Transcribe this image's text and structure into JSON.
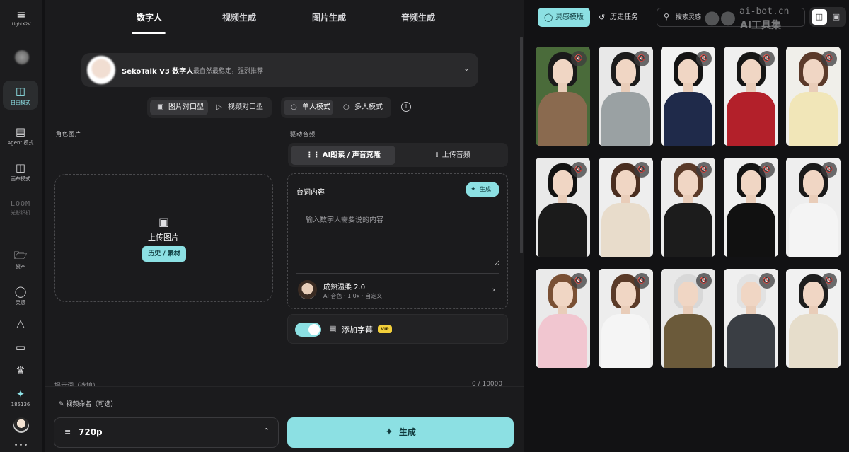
{
  "app": {
    "logo_text": "LightX2V"
  },
  "rail": {
    "items": [
      {
        "label": "自由模式",
        "icon": "cube-icon"
      },
      {
        "label": "Agent 模式",
        "icon": "robot-icon"
      },
      {
        "label": "画布模式",
        "icon": "layout-icon"
      },
      {
        "label": "LOOM",
        "sub": "光影织机",
        "icon": "loom-logo"
      },
      {
        "label": "资产",
        "icon": "folder-icon"
      },
      {
        "label": "灵感",
        "icon": "bulb-icon"
      },
      {
        "label": "",
        "icon": "bell-icon"
      },
      {
        "label": "",
        "icon": "monitor-icon"
      },
      {
        "label": "",
        "icon": "crown-icon"
      },
      {
        "label": "185136",
        "icon": "sparkle-icon"
      }
    ],
    "more": "•••"
  },
  "tabs": [
    "数字人",
    "视频生成",
    "图片生成",
    "音频生成"
  ],
  "model": {
    "name": "SekoTalk V3 数字人",
    "desc": "最自然最稳定，强烈推荐"
  },
  "lipsync": {
    "options": [
      "图片对口型",
      "视频对口型"
    ],
    "selected": "图片对口型"
  },
  "mode": {
    "options": [
      "单人模式",
      "多人模式"
    ],
    "selected": "单人模式"
  },
  "role_image": {
    "label": "角色图片",
    "upload_text": "上传图片",
    "history_button": "历史 / 素材"
  },
  "audio": {
    "label": "驱动音频",
    "tabs": [
      "AI朗读 / 声音克隆",
      "上传音频"
    ],
    "selected": "AI朗读 / 声音克隆"
  },
  "script": {
    "title": "台词内容",
    "generate_label": "生成",
    "placeholder": "输入数字人需要说的内容",
    "value": ""
  },
  "voice": {
    "name": "成熟温柔 2.0",
    "meta": "AI 音色 · 1.0x · 自定义"
  },
  "subtitle": {
    "label": "添加字幕",
    "badge": "VIP",
    "enabled": true
  },
  "prompt_row": {
    "label": "提示词（选填）",
    "counter": "0 / 10000"
  },
  "bottom": {
    "video_name_label": "视频命名（可选）",
    "resolution": "720p",
    "generate_button": "生成"
  },
  "right": {
    "tabs": [
      "灵感模版",
      "历史任务"
    ],
    "selected_tab": "灵感模版",
    "search_placeholder": "搜索灵感",
    "watermark_line1": "ai-bot.cn",
    "watermark_line2": "AI工具集",
    "view_modes": [
      "split-view-icon",
      "single-view-icon"
    ],
    "selected_view": "split-view-icon"
  },
  "templates": [
    {
      "hair": "#1a1a1a",
      "body": "#8a6a4f",
      "bg": "#4a6b3a"
    },
    {
      "hair": "#1c1c1c",
      "body": "#9aa1a3",
      "bg": "#e8e8e8"
    },
    {
      "hair": "#141414",
      "body": "#1f2a4a",
      "bg": "#f2f2f2"
    },
    {
      "hair": "#151515",
      "body": "#b3202a",
      "bg": "#efefef"
    },
    {
      "hair": "#5b3a2a",
      "body": "#f1e6b8",
      "bg": "#f0efea"
    },
    {
      "hair": "#121212",
      "body": "#1b1b1b",
      "bg": "#e9e9e9"
    },
    {
      "hair": "#4a2e20",
      "body": "#e8dccb",
      "bg": "#eeeeee"
    },
    {
      "hair": "#5a3a28",
      "body": "#1c1c1c",
      "bg": "#ececec"
    },
    {
      "hair": "#121212",
      "body": "#111111",
      "bg": "#efefef"
    },
    {
      "hair": "#1a1a1a",
      "body": "#f4f4f4",
      "bg": "#eeeeee"
    },
    {
      "hair": "#7a5034",
      "body": "#f1c6d0",
      "bg": "#eaeaea"
    },
    {
      "hair": "#5a3a28",
      "body": "#f5f5f5",
      "bg": "#ededed"
    },
    {
      "hair": "#d8d8d8",
      "body": "#6b5a3a",
      "bg": "#e8e8e8"
    },
    {
      "hair": "#e2e2e2",
      "body": "#3a3e44",
      "bg": "#efefef"
    },
    {
      "hair": "#1e1e1e",
      "body": "#e6ddcb",
      "bg": "#f1f1f1"
    }
  ],
  "colors": {
    "accent": "#8ce0e3",
    "panel": "#1b1b1d",
    "background": "#121214"
  }
}
